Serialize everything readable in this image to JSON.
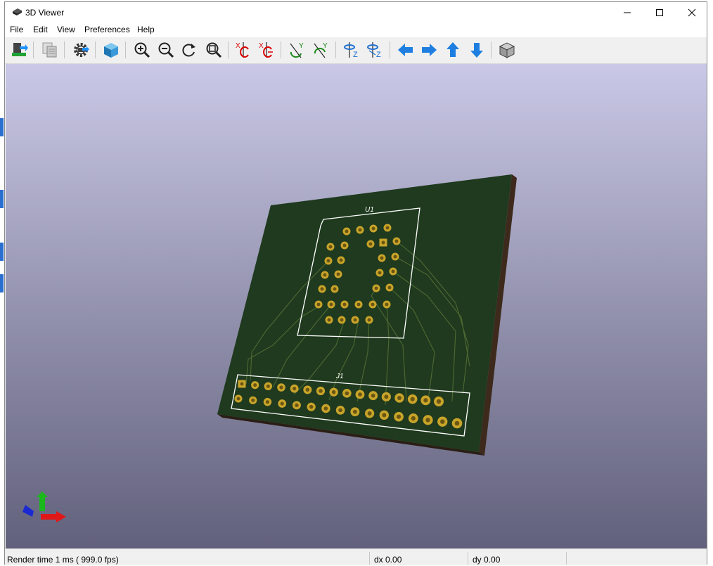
{
  "window": {
    "title": "3D Viewer"
  },
  "menu": [
    "File",
    "Edit",
    "View",
    "Preferences",
    "Help"
  ],
  "toolbar": {
    "items": [
      {
        "name": "reload-board-button",
        "icon": "reload-board-icon"
      },
      {
        "name": "copy-image-button",
        "icon": "copy-icon"
      },
      {
        "name": "settings-button",
        "icon": "gear-icon"
      },
      {
        "name": "raytracing-button",
        "icon": "cube-render-icon"
      },
      {
        "name": "zoom-in-button",
        "icon": "zoom-in-icon"
      },
      {
        "name": "zoom-out-button",
        "icon": "zoom-out-icon"
      },
      {
        "name": "redraw-button",
        "icon": "redraw-icon"
      },
      {
        "name": "zoom-fit-button",
        "icon": "zoom-fit-icon"
      },
      {
        "name": "rotate-x-cw-button",
        "icon": "rotate-x-cw-icon"
      },
      {
        "name": "rotate-x-ccw-button",
        "icon": "rotate-x-ccw-icon"
      },
      {
        "name": "rotate-y-cw-button",
        "icon": "rotate-y-cw-icon"
      },
      {
        "name": "rotate-y-ccw-button",
        "icon": "rotate-y-ccw-icon"
      },
      {
        "name": "rotate-z-cw-button",
        "icon": "rotate-z-cw-icon"
      },
      {
        "name": "rotate-z-ccw-button",
        "icon": "rotate-z-ccw-icon"
      },
      {
        "name": "pan-left-button",
        "icon": "arrow-left-icon"
      },
      {
        "name": "pan-right-button",
        "icon": "arrow-right-icon"
      },
      {
        "name": "pan-up-button",
        "icon": "arrow-up-icon"
      },
      {
        "name": "pan-down-button",
        "icon": "arrow-down-icon"
      },
      {
        "name": "ortho-toggle-button",
        "icon": "ortho-cube-icon"
      }
    ],
    "axis_labels": {
      "x": "X",
      "y": "Y",
      "z": "Z"
    }
  },
  "board": {
    "u1_label": "U1",
    "j1_label": "J1",
    "colors": {
      "board": "#1f3a1e",
      "edge": "#4a3422",
      "pad": "#c8a42a",
      "hole": "#6b5512",
      "silk": "#ffffff",
      "trace": "#4f6a33"
    }
  },
  "status": {
    "render_time": "Render time 1 ms ( 999.0 fps)",
    "dx": "dx 0.00",
    "dy": "dy 0.00"
  }
}
